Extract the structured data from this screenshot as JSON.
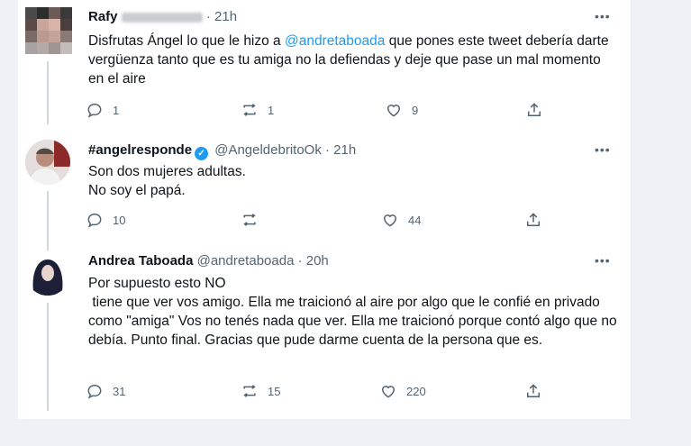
{
  "tweets": [
    {
      "name": "Rafy",
      "handle_hidden": true,
      "time": "· 21h",
      "more": "•••",
      "body_pre": "Disfrutas Ángel lo que le hizo a ",
      "mention": "@andretaboada",
      "body_post": "  que pones este tweet debería darte vergüenza tanto que es tu amiga no la defiendas y deje que pase un mal momento en el aire",
      "replies": "1",
      "retweets": "1",
      "likes": "9"
    },
    {
      "name": "#angelresponde",
      "verified": true,
      "handle": "@AngeldebritoOk · 21h",
      "more": "•••",
      "lines": [
        "Son dos mujeres adultas.",
        "No soy el papá."
      ],
      "replies": "10",
      "retweets": "",
      "likes": "44"
    },
    {
      "name": "Andrea Taboada",
      "handle": "@andretaboada · 20h",
      "more": "•••",
      "lines": [
        "Por supuesto esto NO",
        " tiene que ver vos amigo. Ella me traicionó al aire por algo que le confié en privado como \"amiga\" Vos no tenés nada que ver. Ella me traicionó porque contó algo que no debía. Punto final. Gracias que pude darme cuenta de la persona que es."
      ],
      "replies": "31",
      "retweets": "15",
      "likes": "220"
    }
  ],
  "colors": {
    "accent": "#1d9bf0",
    "muted": "#536471",
    "text": "#0f1419",
    "page_bg": "#eef2f6"
  }
}
